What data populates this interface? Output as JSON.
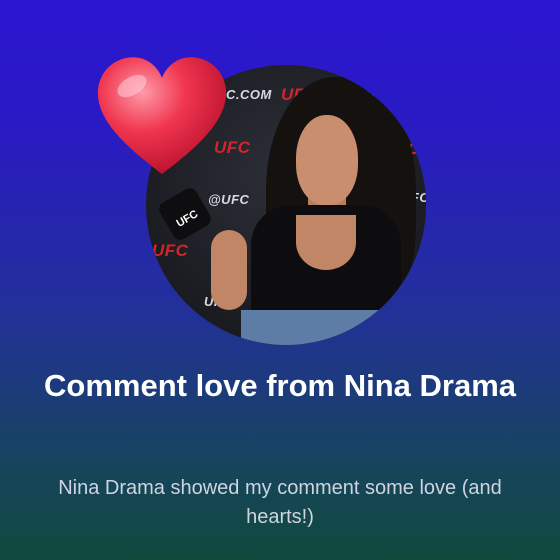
{
  "card": {
    "title": "Comment love from Nina Drama",
    "subtitle": "Nina Drama showed my comment some love (and hearts!)"
  },
  "avatar": {
    "backdrop_texts": [
      "C.COM",
      "UFC",
      "UFC",
      "@UFC",
      "UFC",
      "UFC",
      "UFC",
      "UFC.",
      "UFC"
    ],
    "mic_label": "UFC"
  },
  "icons": {
    "reaction": "heart-icon"
  },
  "colors": {
    "background_top": "#2a16d0",
    "background_bottom": "#104a3c",
    "heart": "#f0354f",
    "ufc_red": "#d4242a"
  }
}
